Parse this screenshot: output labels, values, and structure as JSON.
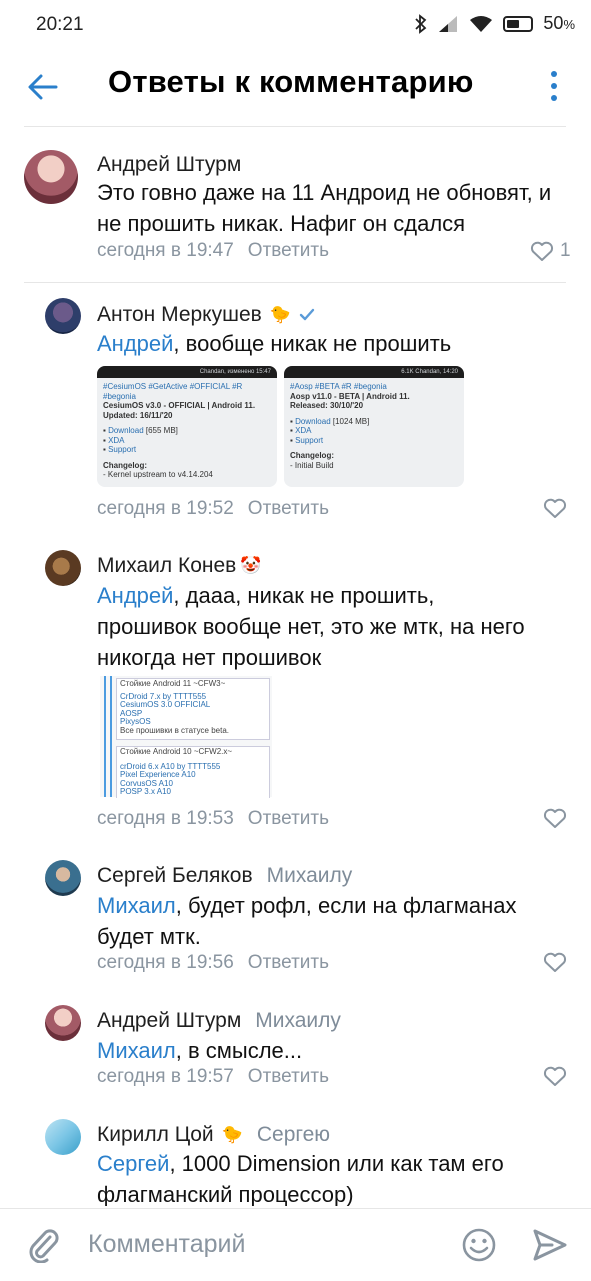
{
  "status_bar": {
    "time": "20:21",
    "battery": "50",
    "battery_unit": "%"
  },
  "header": {
    "title": "Ответы к комментарию"
  },
  "comments": [
    {
      "author": "Андрей Штурм",
      "text": "Это говно даже на 11 Андроид не обновят, и не прошить никак. Нафиг он сдался",
      "time": "сегодня в 19:47",
      "reply_label": "Ответить",
      "likes": "1"
    },
    {
      "author": "Антон Меркушев",
      "emoji": "🐤",
      "mention": "Андрей",
      "text": ", вообще никак не прошить",
      "time": "сегодня в 19:52",
      "reply_label": "Ответить",
      "attachments": [
        {
          "bar": "Chandan, изменено 15:47",
          "tags": "#CesiumOS #GetActive #OFFICIAL #R #begonia",
          "title": "CesiumOS v3.0 - OFFICIAL | Android 11.",
          "updated": "Updated: 16/11/'20",
          "download": "Download",
          "size": "[655 MB]",
          "xda": "XDA",
          "support": "Support",
          "changelog": "Changelog:",
          "change1": "- Kernel upstream to v4.14.204"
        },
        {
          "bar": "6.1K Chandan, 14:20",
          "tags": "#Aosp #BETA #R #begonia",
          "title": "Aosp v11.0 - BETA | Android 11.",
          "updated": "Released: 30/10/'20",
          "download": "Download",
          "size": "[1024 MB]",
          "xda": "XDA",
          "support": "Support",
          "changelog": "Changelog:",
          "change1": "- Initial Build"
        }
      ]
    },
    {
      "author": "Михаил Конев",
      "emoji": "🤡",
      "mention": "Андрей",
      "text": ", дааа, никак не прошить, прошивок вообще нет, это же мтк, на него никогда нет прошивок",
      "time": "сегодня в 19:53",
      "reply_label": "Ответить",
      "attachment": {
        "head1": "Стойкие Android 11 ~CFW3~",
        "l1": "CrDroid 7.x by TTTT555",
        "l2": "CesiumOS 3.0 OFFICIAL",
        "l3": "AOSP",
        "l4": "PixysOS",
        "l5": "Все прошивки в статусе beta.",
        "head2": "Стойкие Android 10 ~CFW2.x~",
        "m1": "crDroid 6.x A10 by TTTT555",
        "m2": "Pixel Experience A10",
        "m3": "CorvusOS A10",
        "m4": "POSP 3.x A10"
      }
    },
    {
      "author": "Сергей Беляков",
      "reply_to": "Михаилу",
      "mention": "Михаил",
      "text": ", будет рофл, если на флагманах будет мтк.",
      "time": "сегодня в 19:56",
      "reply_label": "Ответить"
    },
    {
      "author": "Андрей Штурм",
      "reply_to": "Михаилу",
      "mention": "Михаил",
      "text": ", в смысле...",
      "time": "сегодня в 19:57",
      "reply_label": "Ответить"
    },
    {
      "author": "Кирилл Цой",
      "emoji": "🐤",
      "reply_to": "Сергею",
      "mention": "Сергей",
      "text": ", 1000 Dimension или как там его флагманский процессор)"
    }
  ],
  "input": {
    "placeholder": "Комментарий"
  },
  "colors": {
    "accent": "#2a7fcb",
    "meta": "#8a95a0"
  }
}
